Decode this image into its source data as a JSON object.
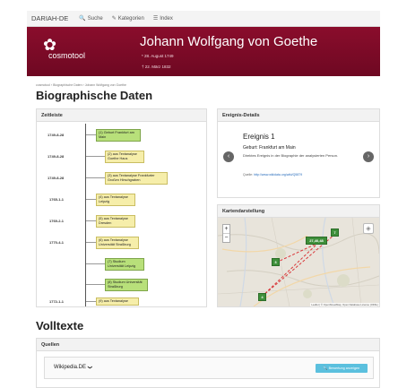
{
  "topbar": {
    "brand": "DARIAH-DE",
    "nav": [
      {
        "icon": "search-icon",
        "glyph": "🔍",
        "label": "Suche"
      },
      {
        "icon": "tag-icon",
        "glyph": "✎",
        "label": "Kategorien"
      },
      {
        "icon": "list-icon",
        "glyph": "☰",
        "label": "Index"
      }
    ]
  },
  "banner": {
    "logo_text": "cosmotool",
    "title": "Johann Wolfgang von Goethe",
    "birth": "* 28. August 1749",
    "death": "† 22. März 1832"
  },
  "breadcrumb": [
    "cosmotool",
    "Biographische Daten",
    "Johann Wolfgang von Goethe"
  ],
  "page_title": "Biographische Daten",
  "timeline": {
    "title": "Zeitleiste",
    "entries": [
      {
        "date": "1749-8-28",
        "label": "(1) Geburt Frankfurt am Main",
        "color": "green"
      },
      {
        "date": "1749-8-28",
        "label": "(2) aus Textanalyse Goethe Haus",
        "color": "yellow"
      },
      {
        "date": "1749-8-28",
        "label": "(3) aus Textanalyse Frankfurter Großen Hirschgraben",
        "color": "yellow"
      },
      {
        "date": "1765-1-1",
        "label": "(4) aus Textanalyse Leipzig",
        "color": "yellow"
      },
      {
        "date": "1769-2-1",
        "label": "(5) aus Textanalyse Dresden",
        "color": "yellow"
      },
      {
        "date": "1770-4-1",
        "label": "(6) aus Textanalyse Universität Straßburg",
        "color": "yellow"
      },
      {
        "date": "",
        "label": "(7) Studium Universität Leipzig",
        "color": "green"
      },
      {
        "date": "",
        "label": "(8) Studium Universität Straßburg",
        "color": "green"
      },
      {
        "date": "1772-1-1",
        "label": "(9) aus Textanalyse",
        "color": "yellow"
      }
    ]
  },
  "event_details": {
    "title": "Ereignis-Details",
    "event_title": "Ereignis 1",
    "event_sub": "Geburt: Frankfurt am Main",
    "description": "Direktes Ereignis in der Biographie der analysierten Person.",
    "source_label": "Quelle:",
    "source_link": "http://www.wikidata.org/wiki/Q5879"
  },
  "map": {
    "title": "Kartendarstellung",
    "zoom_in": "+",
    "zoom_out": "−",
    "markers": [
      "27,40,48",
      "7",
      "3",
      "4"
    ],
    "attribution": "Leaflet | © OpenStreetMap, Open Database License (ODbL)"
  },
  "fulltexts": {
    "title": "Volltexte",
    "panel_title": "Quellen",
    "selected_source": "Wikipedia.DE",
    "action_button": "Bewertung anzeigen"
  },
  "colors": {
    "banner": "#7a0a27",
    "marker": "#3e8f3a",
    "route": "#d9383a",
    "button": "#5bc0de"
  }
}
